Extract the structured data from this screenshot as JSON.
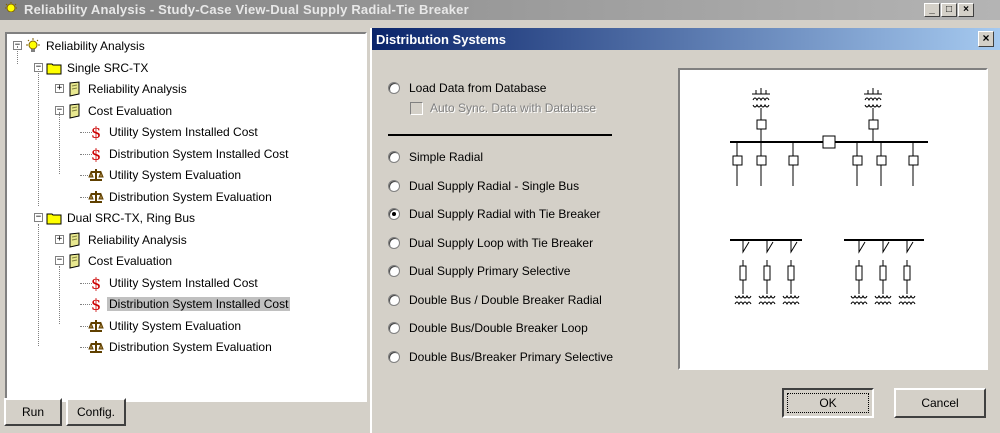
{
  "main_window": {
    "title": "Reliability Analysis - Study-Case View-Dual Supply Radial-Tie Breaker",
    "controls": [
      "_",
      "□",
      "×"
    ]
  },
  "tree": {
    "nodes": [
      {
        "label": "Reliability Analysis",
        "icon": "bulb-icon",
        "expander": "−"
      },
      {
        "label": "Single SRC-TX",
        "icon": "folder-icon",
        "expander": "−"
      },
      {
        "label": "Reliability Analysis",
        "icon": "book-icon",
        "expander": "+"
      },
      {
        "label": "Cost Evaluation",
        "icon": "book-icon",
        "expander": "−"
      },
      {
        "label": "Utility System Installed Cost",
        "icon": "dollar-icon"
      },
      {
        "label": "Distribution System Installed Cost",
        "icon": "dollar-icon"
      },
      {
        "label": "Utility System Evaluation",
        "icon": "scale-icon"
      },
      {
        "label": "Distribution System Evaluation",
        "icon": "scale-icon"
      },
      {
        "label": "Dual SRC-TX, Ring Bus",
        "icon": "folder-icon",
        "expander": "−"
      },
      {
        "label": "Reliability Analysis",
        "icon": "book-icon",
        "expander": "+"
      },
      {
        "label": "Cost Evaluation",
        "icon": "book-icon",
        "expander": "−"
      },
      {
        "label": "Utility System Installed Cost",
        "icon": "dollar-icon"
      },
      {
        "label": "Distribution System Installed Cost",
        "icon": "dollar-icon",
        "selected": true
      },
      {
        "label": "Utility System Evaluation",
        "icon": "scale-icon"
      },
      {
        "label": "Distribution System Evaluation",
        "icon": "scale-icon"
      }
    ]
  },
  "left_buttons": {
    "run": "Run",
    "config": "Config."
  },
  "dialog": {
    "title": "Distribution Systems",
    "close": "×",
    "load_db": {
      "label": "Load Data from Database",
      "checked": false
    },
    "auto_sync": {
      "label": "Auto Sync. Data with Database",
      "checked": false,
      "enabled": false
    },
    "options": [
      {
        "label": "Simple Radial",
        "selected": false
      },
      {
        "label": "Dual Supply Radial - Single Bus",
        "selected": false
      },
      {
        "label": "Dual Supply Radial with Tie Breaker",
        "selected": true
      },
      {
        "label": "Dual Supply Loop with Tie Breaker",
        "selected": false
      },
      {
        "label": "Dual Supply Primary Selective",
        "selected": false
      },
      {
        "label": "Double Bus / Double Breaker Radial",
        "selected": false
      },
      {
        "label": "Double Bus/Double Breaker Loop",
        "selected": false
      },
      {
        "label": "Double Bus/Breaker Primary Selective",
        "selected": false
      }
    ],
    "ok": "OK",
    "cancel": "Cancel"
  },
  "colors": {
    "dialog_title": "#0a246a",
    "main_title": "#808080",
    "face": "#d4d0c8",
    "folder": "#ffff00"
  }
}
